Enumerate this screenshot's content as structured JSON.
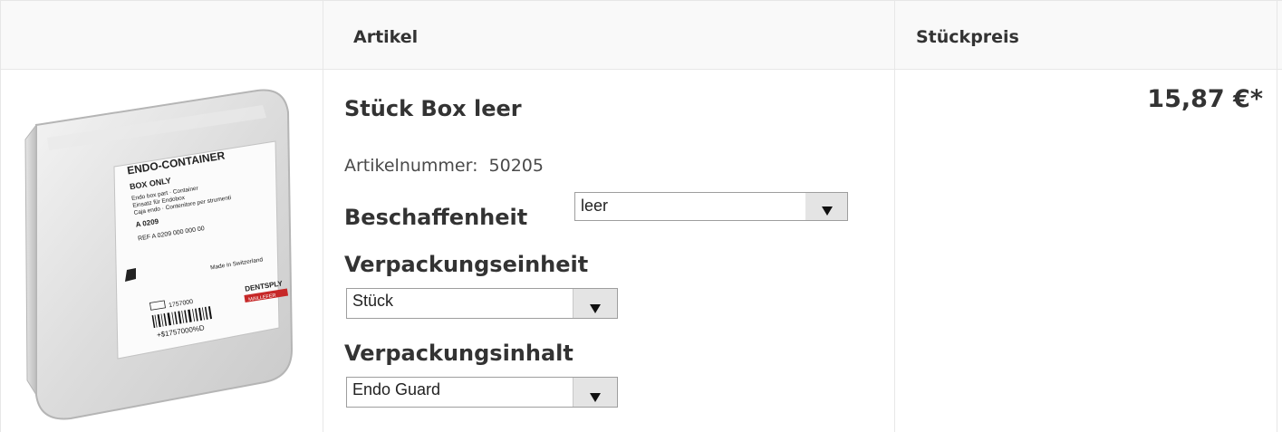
{
  "table": {
    "headers": {
      "artikel": "Artikel",
      "stueckpreis": "Stückpreis"
    }
  },
  "product": {
    "image_label": {
      "title": "ENDO-CONTAINER",
      "subtitle": "BOX ONLY",
      "lines": [
        "Endo box part · Container",
        "Einsatz für Endobox",
        "Caja endo · Contenitore per strumenti"
      ],
      "code": "A 0209",
      "ref": "REF A 0209 000 000 00",
      "origin": "Made in Switzerland",
      "lot": "1757000",
      "barcode_text": "+$1757000%D",
      "brand": "DENTSPLY",
      "brand_sub": "MAILLEFER"
    },
    "name": "Stück Box leer",
    "article_number_label": "Artikelnummer:",
    "article_number": "50205",
    "price": "15,87 €*",
    "options": {
      "beschaffenheit": {
        "label": "Beschaffenheit",
        "selected": "leer"
      },
      "verpackungseinheit": {
        "label": "Verpackungseinheit",
        "selected": "Stück"
      },
      "verpackungsinhalt": {
        "label": "Verpackungsinhalt",
        "selected": "Endo Guard"
      }
    }
  }
}
